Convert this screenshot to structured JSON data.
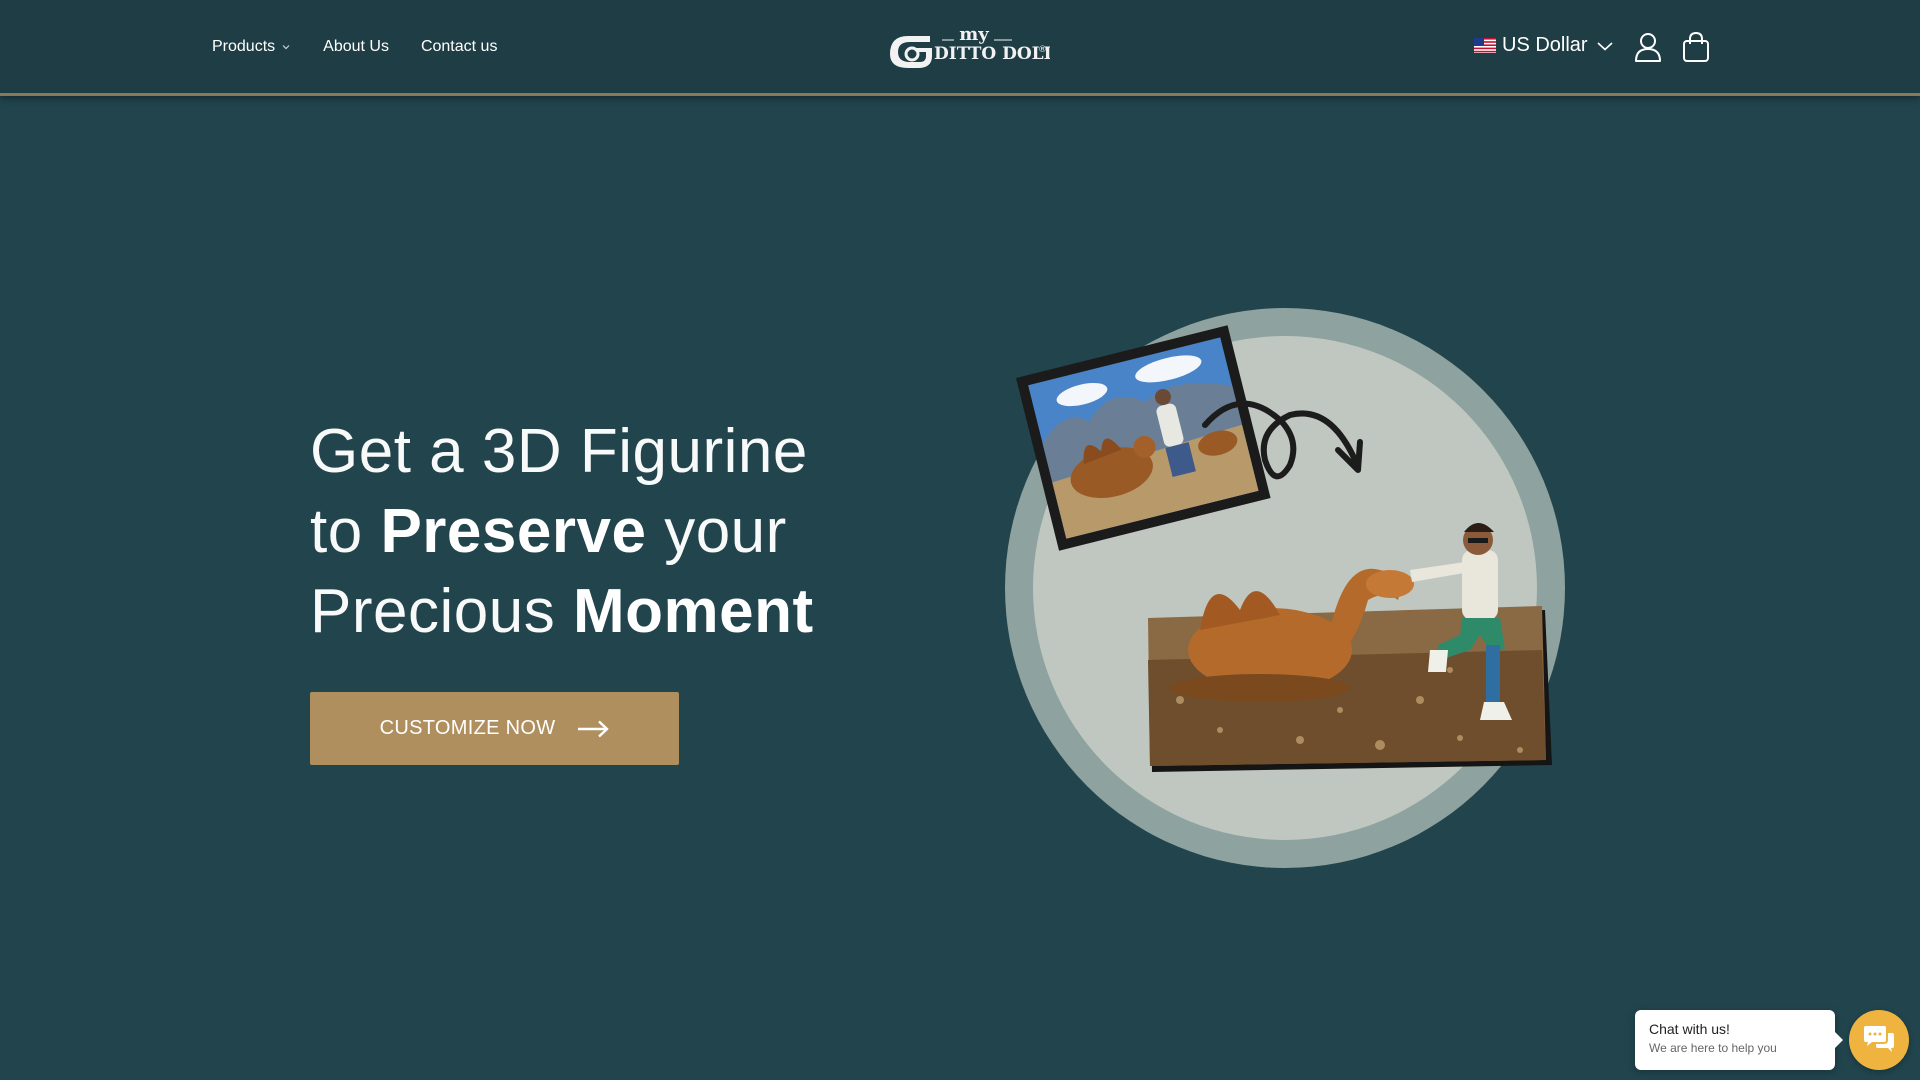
{
  "header": {
    "nav": [
      {
        "label": "Products",
        "has_dropdown": true
      },
      {
        "label": "About Us"
      },
      {
        "label": "Contact us"
      }
    ],
    "logo": {
      "top_text": "my",
      "main_text": "DITTO DOLL",
      "mark": "®"
    },
    "currency": {
      "label": "US Dollar",
      "flag": "us-flag-icon"
    },
    "icons": [
      "user-account-icon",
      "shopping-bag-icon"
    ]
  },
  "hero": {
    "line1": "Get a 3D Figurine",
    "line2_a": "to ",
    "line2_b": "Preserve",
    "line2_c": " your",
    "line3_a": "Precious ",
    "line3_b": "Moment",
    "cta_label": "CUSTOMIZE NOW",
    "image_desc_icon": "photo-to-figurine-illustration"
  },
  "chat": {
    "title": "Chat with us!",
    "subtitle": "We are here to help you"
  },
  "colors": {
    "background": "#21444d",
    "header": "#1e3d45",
    "accent": "#b08f5f",
    "chat_accent": "#efb440"
  }
}
